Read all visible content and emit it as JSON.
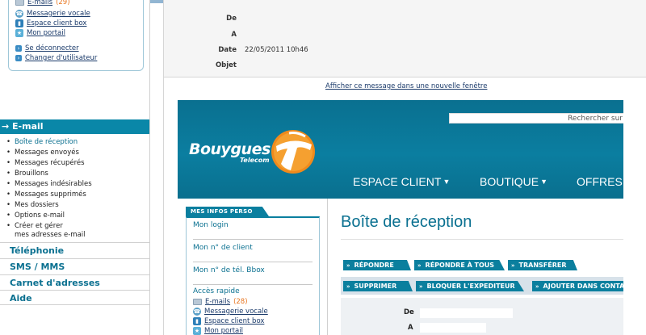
{
  "sidebar": {
    "userbox": {
      "items": [
        {
          "label": "E-mails",
          "count": "(29)",
          "icon": "mail-icon"
        },
        {
          "label": "Messagerie vocale",
          "icon": "phone-icon"
        },
        {
          "label": "Espace client box",
          "icon": "box-icon"
        },
        {
          "label": "Mon portail",
          "icon": "portal-icon"
        }
      ],
      "logout": "Se déconnecter",
      "switch_user": "Changer d'utilisateur"
    },
    "section_title": "→ E-mail",
    "email_items": [
      "Boîte de réception",
      "Messages envoyés",
      "Messages récupérés",
      "Brouillons",
      "Messages indésirables",
      "Messages supprimés",
      "Mes dossiers",
      "Options e-mail",
      "Créer et gérer",
      "mes adresses e-mail"
    ],
    "categories": [
      "Téléphonie",
      "SMS / MMS",
      "Carnet d'adresses",
      "Aide"
    ]
  },
  "message_header": {
    "from_label": "De",
    "to_label": "A",
    "date_label": "Date",
    "date_value": "22/05/2011 10h46",
    "subject_label": "Objet",
    "open_new_window": "Afficher ce message dans une nouvelle fenêtre"
  },
  "embedded": {
    "search_placeholder": "Rechercher sur",
    "logo_text": "Bouygues",
    "logo_sub": "Telecom",
    "nav": [
      "ESPACE CLIENT",
      "BOUTIQUE",
      "OFFRES"
    ],
    "infos_tab": "MES INFOS PERSO",
    "infos_links": [
      "Mon login",
      "Mon n° de client",
      "Mon n° de tél. Bbox"
    ],
    "quick_access": "Accès rapide",
    "quick_items": [
      {
        "label": "E-mails",
        "count": "(28)",
        "icon": "mail-icon"
      },
      {
        "label": "Messagerie vocale",
        "icon": "phone-icon"
      },
      {
        "label": "Espace client box",
        "icon": "box-icon"
      },
      {
        "label": "Mon portail",
        "icon": "portal-icon"
      }
    ],
    "page_title": "Boîte de réception",
    "buttons_row1": [
      "RÉPONDRE",
      "RÉPONDRE À TOUS",
      "TRANSFÉRER"
    ],
    "buttons_row2": [
      "SUPPRIMER",
      "BLOQUER L'EXPEDITEUR",
      "AJOUTER DANS CONTA"
    ],
    "from_label": "De",
    "to_label": "A"
  },
  "colors": {
    "accent": "#0a87a8",
    "count": "#e87722",
    "banner": "#0a7090"
  }
}
